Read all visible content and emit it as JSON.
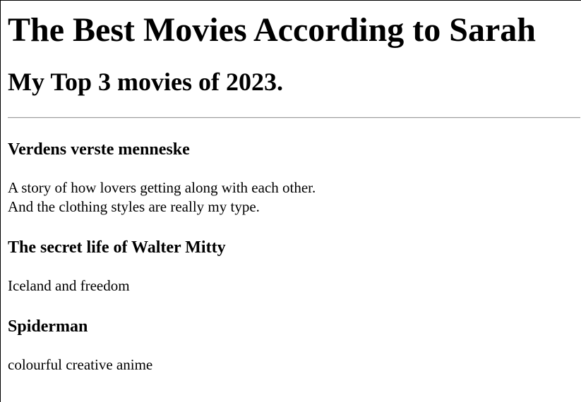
{
  "page": {
    "title": "The Best Movies According to Sarah",
    "subtitle": "My Top 3 movies of 2023."
  },
  "movies": [
    {
      "title": "Verdens verste menneske",
      "description_lines": [
        "A story of how lovers getting along with each other.",
        "And the clothing styles are really my type."
      ]
    },
    {
      "title": "The secret life of Walter Mitty",
      "description_lines": [
        "Iceland and freedom"
      ]
    },
    {
      "title": "Spiderman",
      "description_lines": [
        "colourful creative anime"
      ]
    }
  ]
}
